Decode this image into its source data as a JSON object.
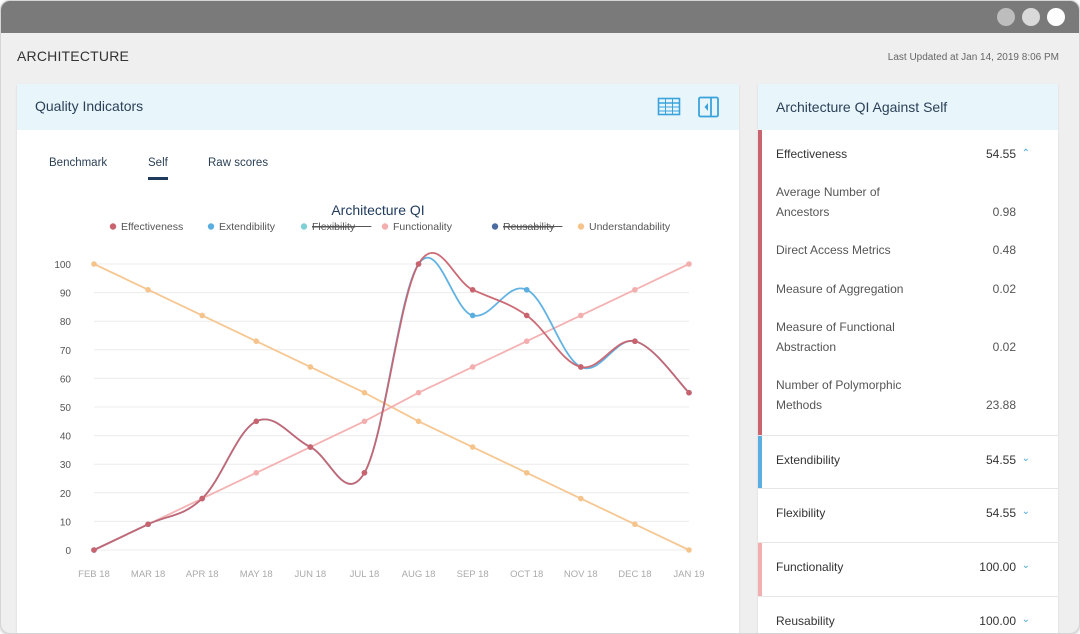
{
  "page": {
    "title": "ARCHITECTURE",
    "last_updated": "Last Updated at Jan 14, 2019 8:06 PM"
  },
  "colors": {
    "Effectiveness": "#c9636e",
    "Extendibility": "#5aaee0",
    "Flexibility": "#7fd0d6",
    "Functionality": "#f3aeae",
    "Reusability": "#4a6ca0",
    "Understandability": "#f5c48c"
  },
  "left_panel": {
    "title": "Quality Indicators",
    "icons": [
      "table-view-icon",
      "panel-toggle-icon"
    ],
    "tabs": [
      "Benchmark",
      "Self",
      "Raw scores"
    ],
    "active_tab": "Self"
  },
  "chart_data": {
    "type": "line",
    "title": "Architecture QI",
    "categories": [
      "FEB 18",
      "MAR 18",
      "APR 18",
      "MAY 18",
      "JUN 18",
      "JUL 18",
      "AUG 18",
      "SEP 18",
      "OCT 18",
      "NOV 18",
      "DEC 18",
      "JAN 19"
    ],
    "ylim": [
      0,
      100
    ],
    "yticks": [
      0,
      10,
      20,
      30,
      40,
      50,
      60,
      70,
      80,
      90,
      100
    ],
    "grid": true,
    "legend": "top",
    "series": [
      {
        "name": "Effectiveness",
        "values": [
          0,
          9,
          18,
          45,
          36,
          27,
          100,
          91,
          82,
          64,
          73,
          55
        ],
        "hidden": false
      },
      {
        "name": "Extendibility",
        "values": [
          0,
          9,
          18,
          45,
          36,
          27,
          100,
          82,
          91,
          64,
          73,
          55
        ],
        "hidden": false
      },
      {
        "name": "Flexibility",
        "values": [],
        "hidden": true
      },
      {
        "name": "Functionality",
        "values": [
          0,
          9,
          18,
          27,
          36,
          45,
          55,
          64,
          73,
          82,
          91,
          100
        ],
        "hidden": false
      },
      {
        "name": "Reusability",
        "values": [],
        "hidden": true
      },
      {
        "name": "Understandability",
        "values": [
          100,
          91,
          82,
          73,
          64,
          55,
          45,
          36,
          27,
          18,
          9,
          0
        ],
        "hidden": false
      }
    ]
  },
  "right_panel": {
    "title": "Architecture QI Against Self",
    "sections": [
      {
        "label": "Effectiveness",
        "value": "54.55",
        "expanded": true,
        "metrics": [
          {
            "label": "Average Number of Ancestors",
            "value": "0.98"
          },
          {
            "label": "Direct Access Metrics",
            "value": "0.48"
          },
          {
            "label": "Measure of Aggregation",
            "value": "0.02"
          },
          {
            "label": "Measure of Functional Abstraction",
            "value": "0.02"
          },
          {
            "label": "Number of Polymorphic Methods",
            "value": "23.88"
          }
        ]
      },
      {
        "label": "Extendibility",
        "value": "54.55",
        "expanded": false
      },
      {
        "label": "Flexibility",
        "value": "54.55",
        "expanded": false
      },
      {
        "label": "Functionality",
        "value": "100.00",
        "expanded": false
      },
      {
        "label": "Reusability",
        "value": "100.00",
        "expanded": false
      }
    ]
  }
}
